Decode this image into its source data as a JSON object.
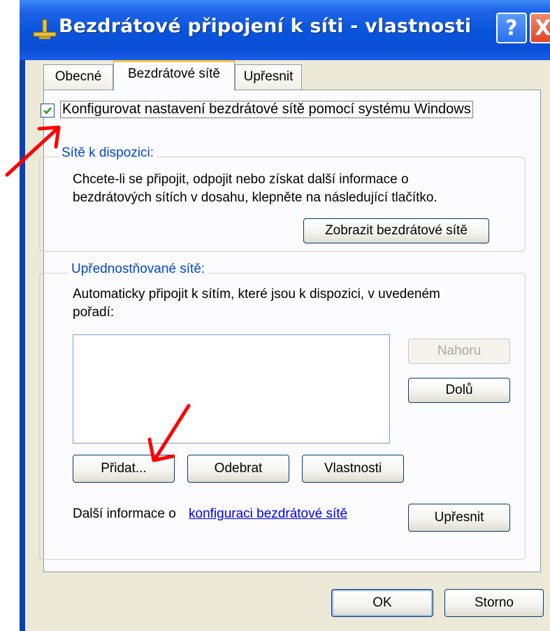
{
  "window": {
    "title": "Bezdrátové připojení k síti - vlastnosti",
    "help_label": "?",
    "close_label": "X"
  },
  "tabs": [
    {
      "label": "Obecné"
    },
    {
      "label": "Bezdrátové sítě"
    },
    {
      "label": "Upřesnit"
    }
  ],
  "wireless": {
    "configure_checkbox_label": "Konfigurovat nastavení bezdrátové sítě pomocí systému Windows",
    "configure_checked": true,
    "available": {
      "legend": "Sítě k dispozici:",
      "text_line1": "Chcete-li se připojit, odpojit nebo získat další informace o",
      "text_line2": "bezdrátových sítích v dosahu, klepněte na následující tlačítko.",
      "show_button": "Zobrazit bezdrátové sítě"
    },
    "preferred": {
      "legend": "Upřednostňované sítě:",
      "text_line1": "Automaticky připojit k sítím, které jsou k dispozici, v uvedeném",
      "text_line2": "pořadí:",
      "up_button": "Nahoru",
      "down_button": "Dolů",
      "add_button": "Přidat...",
      "remove_button": "Odebrat",
      "properties_button": "Vlastnosti"
    },
    "info_text": "Další informace o",
    "info_link": "konfiguraci bezdrátové sítě",
    "advanced_button": "Upřesnit"
  },
  "footer": {
    "ok_button": "OK",
    "cancel_button": "Storno"
  },
  "colors": {
    "title_bar": "#0855dd",
    "dialog_bg": "#ece9d8",
    "legend_text": "#0046d5",
    "annotation_arrow": "#ff0000"
  }
}
